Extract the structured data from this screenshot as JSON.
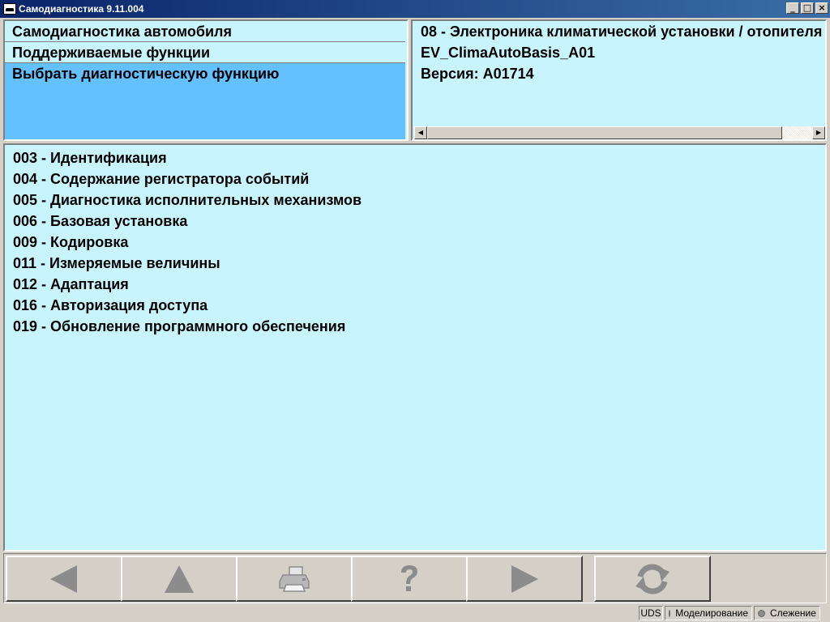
{
  "window": {
    "title": "Самодиагностика 9.11.004",
    "minimize": "_",
    "maximize": "□",
    "close": "×"
  },
  "menu": {
    "items": [
      {
        "label": "Самодиагностика автомобиля"
      },
      {
        "label": "Поддерживаемые функции"
      },
      {
        "label": "Выбрать диагностическую функцию",
        "selected": true
      }
    ]
  },
  "info": {
    "lines": [
      "08 - Электроника климатической установки / отопителя",
      "EV_ClimaAutoBasis_A01",
      "Версия: A01714"
    ]
  },
  "functions": [
    "003 - Идентификация",
    "004 - Содержание регистратора событий",
    "005 - Диагностика исполнительных механизмов",
    "006 - Базовая установка",
    "009 - Кодировка",
    "011 - Измеряемые величины",
    "012 - Адаптация",
    "016 - Авторизация доступа",
    "019 - Обновление программного обеспечения"
  ],
  "toolbar": {
    "buttons": [
      {
        "icon": "arrow-left-icon"
      },
      {
        "icon": "arrow-up-icon"
      },
      {
        "icon": "printer-icon"
      },
      {
        "icon": "help-icon"
      },
      {
        "icon": "arrow-right-icon"
      },
      {
        "icon": "refresh-icon"
      }
    ]
  },
  "status": {
    "protocol": "UDS",
    "simulation": "Моделирование",
    "tracking": "Слежение"
  },
  "colors": {
    "pane_bg": "#c8f4fd",
    "selected_bg": "#64c1ff",
    "icon_gray": "#8c8c8c"
  }
}
